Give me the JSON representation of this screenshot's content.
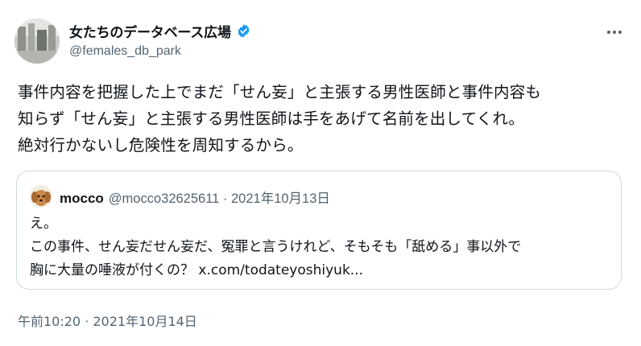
{
  "author": {
    "display_name": "女たちのデータベース広場",
    "handle": "@females_db_park",
    "verified": true,
    "verified_color": "#1d9bf0"
  },
  "tweet": {
    "text": "事件内容を把握した上でまだ「せん妄」と主張する男性医師と事件内容も\n知らず「せん妄」と主張する男性医師は手をあげて名前を出してくれ。\n絶対行かないし危険性を周知するから。",
    "timestamp": "午前10:20 · 2021年10月14日"
  },
  "quoted": {
    "name": "mocco",
    "meta": "@mocco32625611 · 2021年10月13日",
    "text": "え。\nこの事件、せん妄だせん妄だ、冤罪と言うけれど、そもそも「舐める」事以外で\n胸に大量の唾液が付くの？ x.com/todateyoshiyuk..."
  },
  "icons": {
    "more": "more-horizontal-icon",
    "verified": "verified-badge-icon"
  }
}
